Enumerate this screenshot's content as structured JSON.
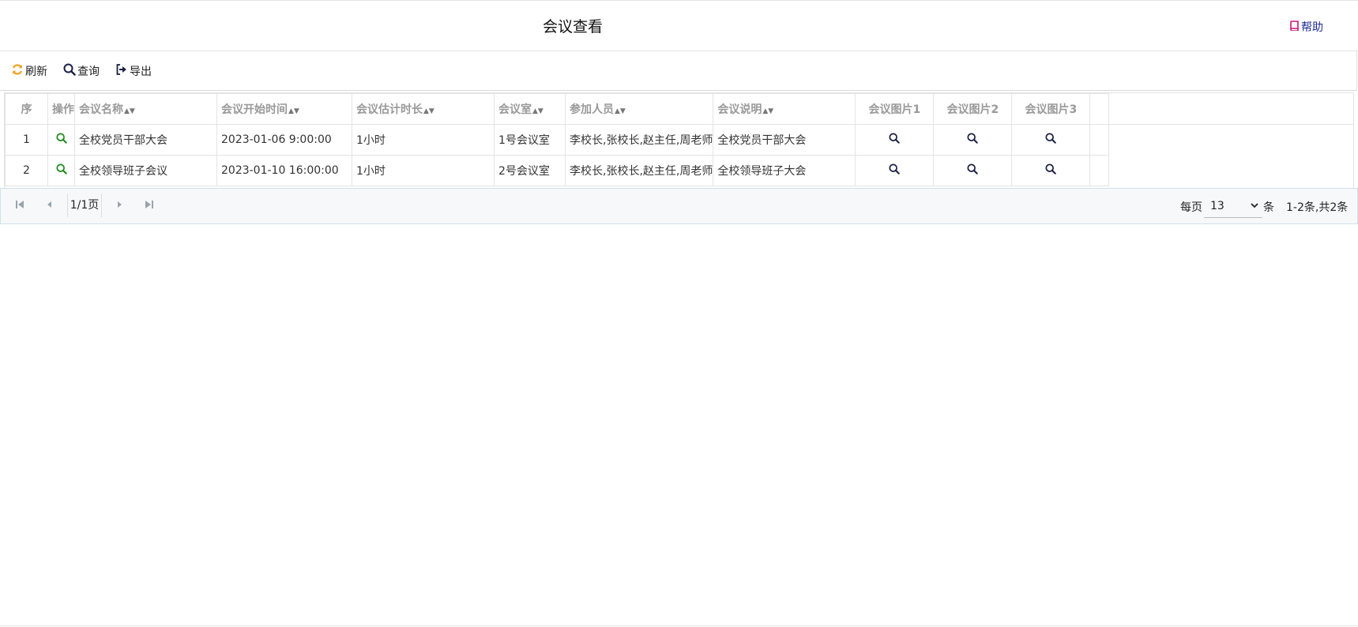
{
  "header": {
    "title": "会议查看",
    "help_label": "帮助"
  },
  "toolbar": {
    "refresh_label": "刷新",
    "query_label": "查询",
    "export_label": "导出"
  },
  "table": {
    "columns": [
      "序",
      "操作",
      "会议名称",
      "会议开始时间",
      "会议估计时长",
      "会议室",
      "参加人员",
      "会议说明",
      "会议图片1",
      "会议图片2",
      "会议图片3"
    ],
    "rows": [
      {
        "index": "1",
        "name": "全校党员干部大会",
        "start": "2023-01-06 9:00:00",
        "duration": "1小时",
        "room": "1号会议室",
        "attendees": "李校长,张校长,赵主任,周老师",
        "desc": "全校党员干部大会"
      },
      {
        "index": "2",
        "name": "全校领导班子会议",
        "start": "2023-01-10 16:00:00",
        "duration": "1小时",
        "room": "2号会议室",
        "attendees": "李校长,张校长,赵主任,周老师",
        "desc": "全校领导班子大会"
      }
    ]
  },
  "pager": {
    "page_label": "1/1页",
    "per_page_label": "每页",
    "per_page_value": "13",
    "unit_label": "条",
    "total_label": "1-2条,共2条"
  },
  "colors": {
    "accent_orange": "#f0a020",
    "view_green": "#1a8a1a",
    "help_blue": "#1d2b9a",
    "help_icon": "#c8197b"
  }
}
